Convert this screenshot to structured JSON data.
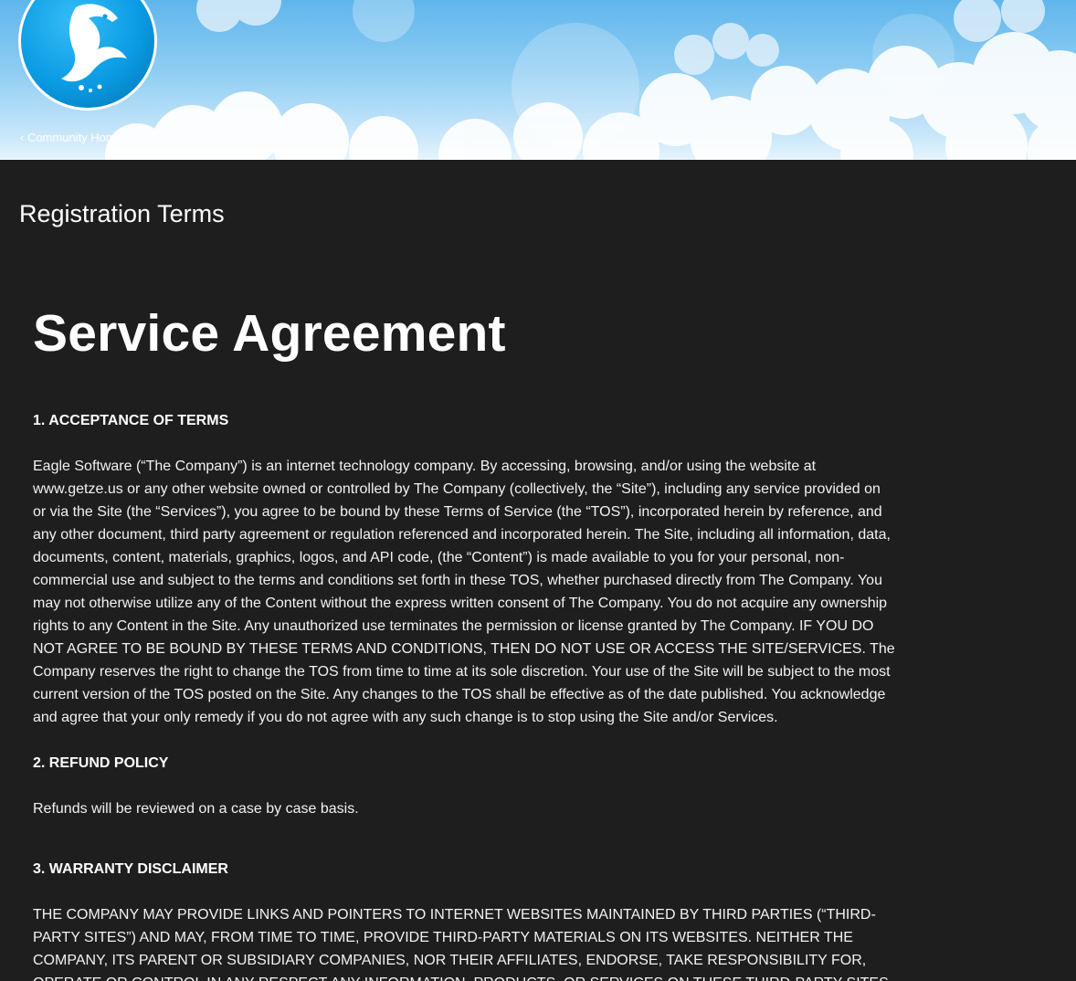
{
  "header": {
    "community_link": "‹ Community Home"
  },
  "page": {
    "title": "Registration Terms"
  },
  "agreement": {
    "title": "Service Agreement",
    "sections": [
      {
        "heading": "1. ACCEPTANCE OF TERMS",
        "body": "Eagle Software (“The Company”) is an internet technology company. By accessing, browsing, and/or using the website at www.getze.us or any other website owned or controlled by The Company (collectively, the “Site”), including any service provided on or via the Site (the “Services”), you agree to be bound by these Terms of Service (the “TOS”), incorporated herein by reference, and any other document, third party agreement or regulation referenced and incorporated herein. The Site, including all information, data, documents, content, materials, graphics, logos, and API code, (the “Content”) is made available to you for your personal, non-commercial use and subject to the terms and conditions set forth in these TOS, whether purchased directly from The Company. You may not otherwise utilize any of the Content without the express written consent of The Company. You do not acquire any ownership rights to any Content in the Site. Any unauthorized use terminates the permission or license granted by The Company. IF YOU DO NOT AGREE TO BE BOUND BY THESE TERMS AND CONDITIONS, THEN DO NOT USE OR ACCESS THE SITE/SERVICES. The Company reserves the right to change the TOS from time to time at its sole discretion. Your use of the Site will be subject to the most current version of the TOS posted on the Site. Any changes to the TOS shall be effective as of the date published. You acknowledge and agree that your only remedy if you do not agree with any such change is to stop using the Site and/or Services."
      },
      {
        "heading": "2. REFUND POLICY",
        "body": "Refunds will be reviewed on a case by case basis."
      },
      {
        "heading": "3. WARRANTY DISCLAIMER",
        "body": "THE COMPANY MAY PROVIDE LINKS AND POINTERS TO INTERNET WEBSITES MAINTAINED BY THIRD PARTIES (“THIRD-PARTY SITES”) AND MAY, FROM TIME TO TIME, PROVIDE THIRD-PARTY MATERIALS ON ITS WEBSITES. NEITHER THE COMPANY, ITS PARENT OR SUBSIDIARY COMPANIES, NOR THEIR AFFILIATES, ENDORSE, TAKE RESPONSIBILITY FOR, OPERATE OR CONTROL IN ANY RESPECT ANY INFORMATION, PRODUCTS, OR SERVICES ON THESE THIRD-PARTY SITES"
      }
    ]
  },
  "colors": {
    "background": "#1e1e1e",
    "text": "#ffffff",
    "sky": "#5fb6ec",
    "logo_blue": "#0a9be3"
  },
  "icons": {
    "logo": "eagle-logo-icon"
  }
}
